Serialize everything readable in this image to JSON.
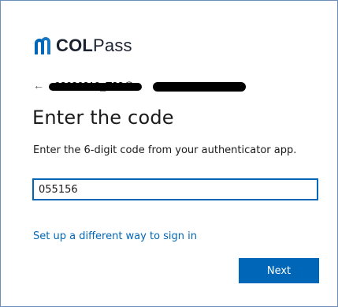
{
  "brand": {
    "name_bold": "COL",
    "name_light": "Pass",
    "accent": "#0067b8"
  },
  "identity": {
    "back_icon": "arrow-left-icon",
    "display": "a02626219_T33@c...(redacted)"
  },
  "title": "Enter the code",
  "description": "Enter the 6-digit code from your authenticator app.",
  "code_input": {
    "value": "055156"
  },
  "alt_link": "Set up a different way to sign in",
  "next_button": "Next"
}
